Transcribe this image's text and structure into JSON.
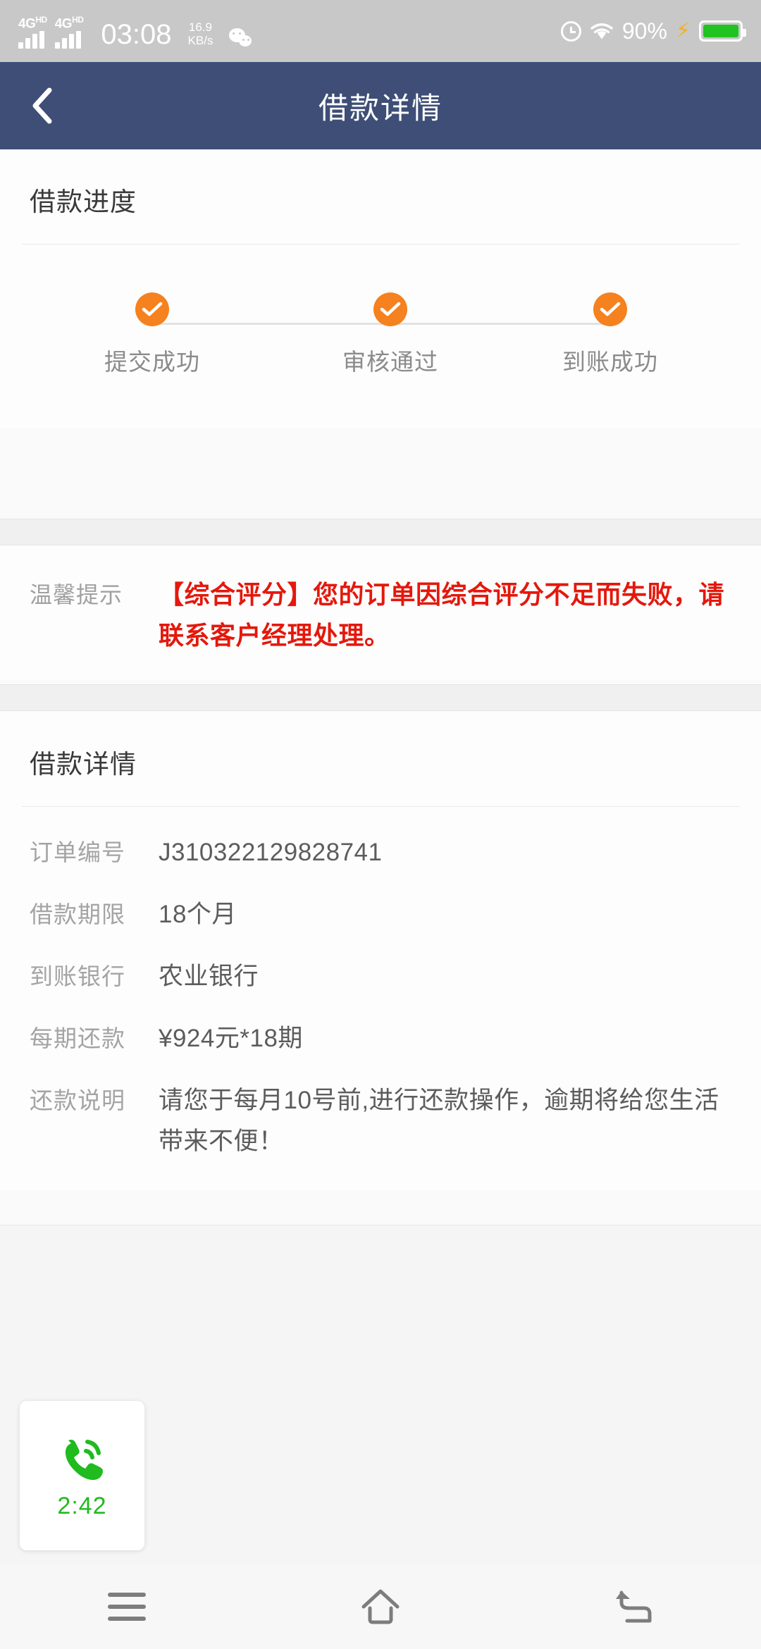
{
  "statusbar": {
    "sim1_network": "4G",
    "sim1_hd": "HD",
    "sim2_network": "4G",
    "sim2_hd": "HD",
    "time": "03:08",
    "speed_value": "16.9",
    "speed_unit": "KB/s",
    "battery_percent": "90%",
    "icons": {
      "wechat": "wechat-icon",
      "alarm": "alarm-icon",
      "wifi": "wifi-icon",
      "charging": "charging-bolt-icon",
      "battery": "battery-icon"
    },
    "colors": {
      "background": "#c8c8c8",
      "battery_fill": "#21c321",
      "bolt": "#f5b01c"
    }
  },
  "header": {
    "title": "借款详情",
    "back_icon": "chevron-left-icon",
    "background": "#3e4e76"
  },
  "progress_section": {
    "title": "借款进度",
    "accent_color": "#f5811f",
    "steps": [
      {
        "label": "提交成功",
        "state": "completed",
        "icon": "check-circle-icon"
      },
      {
        "label": "审核通过",
        "state": "completed",
        "icon": "check-circle-icon"
      },
      {
        "label": "到账成功",
        "state": "completed",
        "icon": "check-circle-icon"
      }
    ]
  },
  "tip_section": {
    "label": "温馨提示",
    "text": "【综合评分】您的订单因综合评分不足而失败，请联系客户经理处理。",
    "text_color": "#e4180c"
  },
  "detail_section": {
    "title": "借款详情",
    "rows": [
      {
        "label": "订单编号",
        "value": "J310322129828741"
      },
      {
        "label": "借款期限",
        "value": "18个月"
      },
      {
        "label": "到账银行",
        "value": "农业银行"
      },
      {
        "label": "每期还款",
        "value": "¥924元*18期"
      },
      {
        "label": "还款说明",
        "value": "请您于每月10号前,进行还款操作，逾期将给您生活带来不便！"
      }
    ]
  },
  "call_widget": {
    "timer": "2:42",
    "icon": "phone-call-icon",
    "color": "#20bb1f"
  },
  "navbar": {
    "buttons": [
      {
        "name": "recents",
        "icon": "hamburger-icon"
      },
      {
        "name": "home",
        "icon": "home-icon"
      },
      {
        "name": "back",
        "icon": "back-arrow-icon"
      }
    ]
  }
}
